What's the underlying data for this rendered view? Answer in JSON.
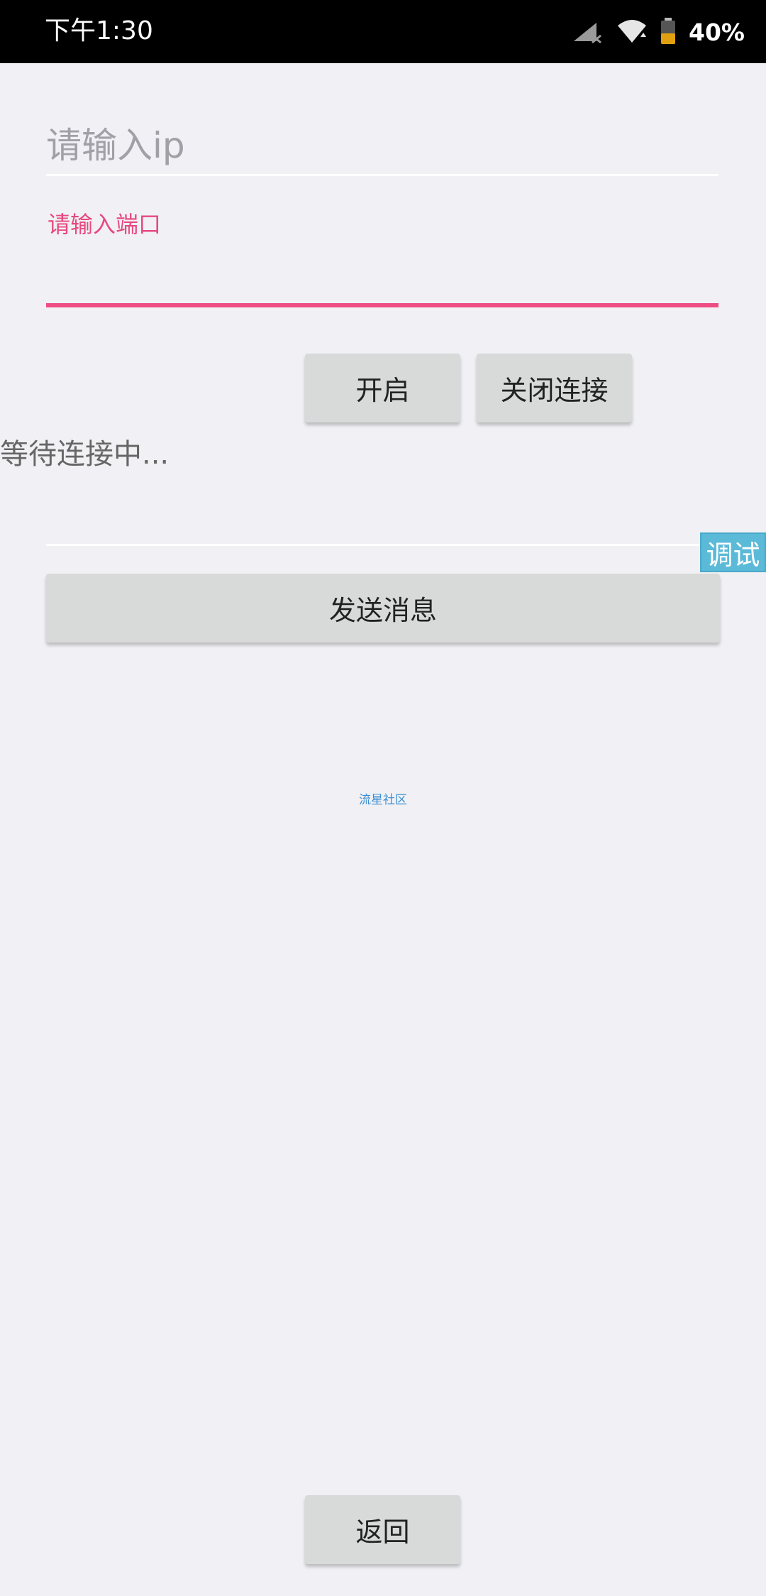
{
  "status_bar": {
    "time": "下午1:30",
    "battery": "40%"
  },
  "form": {
    "ip_placeholder": "请输入ip",
    "ip_value": "",
    "port_label": "请输入端口",
    "port_value": "",
    "message_value": ""
  },
  "buttons": {
    "open": "开启",
    "close_connection": "关闭连接",
    "send_message": "发送消息",
    "back": "返回"
  },
  "status_text": "等待连接中...",
  "debug_badge": "调试",
  "community_link": "流星社区",
  "colors": {
    "accent": "#ee4c82",
    "badge": "#5bbad8",
    "link": "#3c8fd1"
  }
}
